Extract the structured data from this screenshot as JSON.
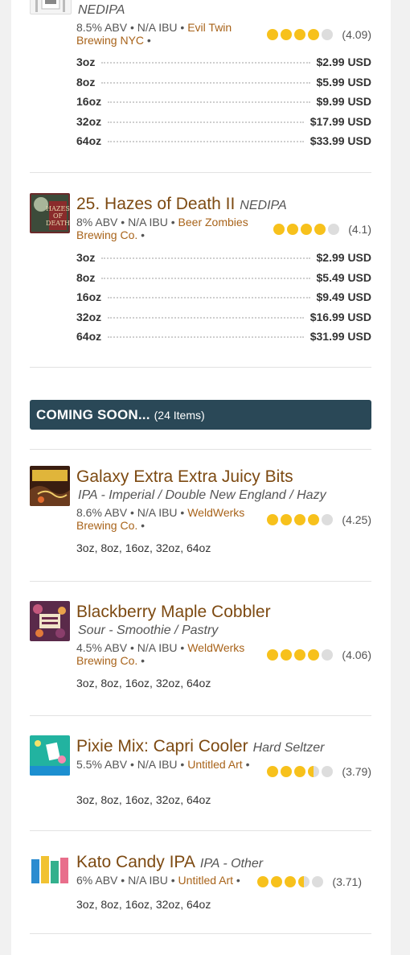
{
  "top_item": {
    "style": "NEDIPA",
    "abv": "8.5% ABV",
    "ibu": "N/A IBU",
    "brewery": "Evil Twin Brewing NYC",
    "rating_text": "(4.09)",
    "rating_value": 4.09,
    "prices": [
      {
        "size": "3oz",
        "price": "$2.99 USD"
      },
      {
        "size": "8oz",
        "price": "$5.99 USD"
      },
      {
        "size": "16oz",
        "price": "$9.99 USD"
      },
      {
        "size": "32oz",
        "price": "$17.99 USD"
      },
      {
        "size": "64oz",
        "price": "$33.99 USD"
      }
    ]
  },
  "item25": {
    "title": "25. Hazes of Death II",
    "style": "NEDIPA",
    "abv": "8% ABV",
    "ibu": "N/A IBU",
    "brewery": "Beer Zombies Brewing Co.",
    "rating_text": "(4.1)",
    "rating_value": 4.1,
    "prices": [
      {
        "size": "3oz",
        "price": "$2.99 USD"
      },
      {
        "size": "8oz",
        "price": "$5.49 USD"
      },
      {
        "size": "16oz",
        "price": "$9.49 USD"
      },
      {
        "size": "32oz",
        "price": "$16.99 USD"
      },
      {
        "size": "64oz",
        "price": "$31.99 USD"
      }
    ]
  },
  "coming_soon": {
    "title": "COMING SOON...",
    "count": "(24 Items)"
  },
  "coming_items": [
    {
      "title": "Galaxy Extra Extra Juicy Bits",
      "style": "IPA - Imperial / Double New England / Hazy",
      "abv": "8.6% ABV",
      "ibu": "N/A IBU",
      "brewery": "WeldWerks Brewing Co.",
      "rating_text": "(4.25)",
      "rating_value": 4.25,
      "sizes": "3oz, 8oz, 16oz, 32oz, 64oz"
    },
    {
      "title": "Blackberry Maple Cobbler",
      "style": "Sour - Smoothie / Pastry",
      "abv": "4.5% ABV",
      "ibu": "N/A IBU",
      "brewery": "WeldWerks Brewing Co.",
      "rating_text": "(4.06)",
      "rating_value": 4.06,
      "sizes": "3oz, 8oz, 16oz, 32oz, 64oz"
    },
    {
      "title": "Pixie Mix: Capri Cooler",
      "style": "Hard Seltzer",
      "abv": "5.5% ABV",
      "ibu": "N/A IBU",
      "brewery": "Untitled Art",
      "rating_text": "(3.79)",
      "rating_value": 3.79,
      "sizes": "3oz, 8oz, 16oz, 32oz, 64oz"
    },
    {
      "title": "Kato Candy IPA",
      "style": "IPA - Other",
      "abv": "6% ABV",
      "ibu": "N/A IBU",
      "brewery": "Untitled Art",
      "rating_text": "(3.71)",
      "rating_value": 3.71,
      "sizes": "3oz, 8oz, 16oz, 32oz, 64oz"
    }
  ],
  "separator": "•",
  "colors": {
    "title": "#7d4a12",
    "link": "#a8631a",
    "rating_on": "#f7c11c",
    "rating_off": "#dddddd",
    "section_header": "#2a4857"
  }
}
